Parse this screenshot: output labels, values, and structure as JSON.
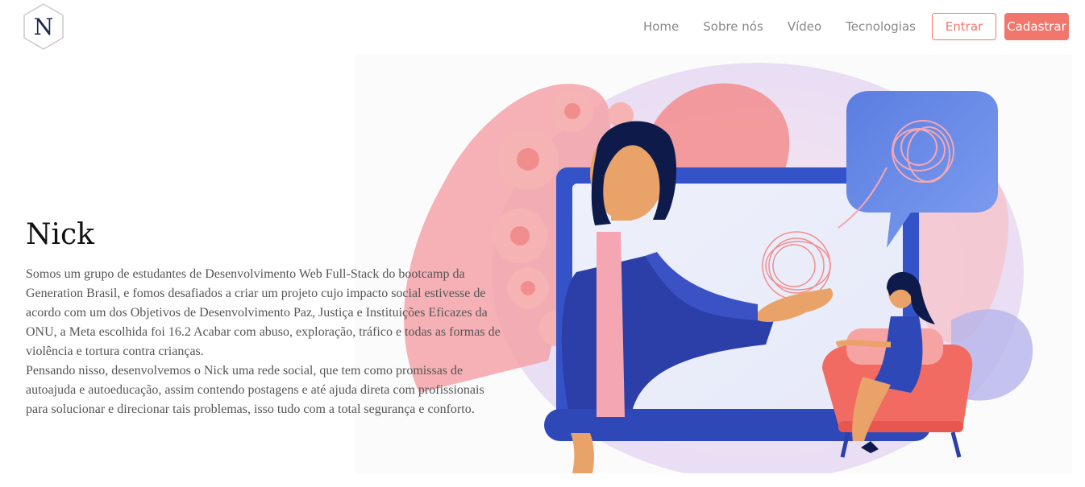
{
  "brand": {
    "logo_letter": "N"
  },
  "nav": {
    "links": [
      "Home",
      "Sobre nós",
      "Vídeo",
      "Tecnologias"
    ],
    "login_label": "Entrar",
    "signup_label": "Cadastrar"
  },
  "hero": {
    "title": "Nick",
    "paragraph_1": "Somos um grupo de estudantes de Desenvolvimento Web Full-Stack do bootcamp da Generation Brasil, e fomos desafiados a criar um projeto cujo impacto social estivesse de acordo com um dos Objetivos de Desenvolvimento Paz, Justiça e Instituições Eficazes da ONU, a Meta escolhida foi 16.2 Acabar com abuso, exploração, tráfico e todas as formas de violência e tortura contra crianças.",
    "paragraph_2": "Pensando nisso, desenvolvemos o Nick uma rede social, que tem como promissas de autoajuda e autoeducação, assim contendo postagens e até ajuda direta com profissionais para solucionar e direcionar tais problemas, isso tudo com a total segurança e conforto."
  },
  "colors": {
    "accent": "#f1766b",
    "navy": "#1d2a6b",
    "blue": "#3e5bd0"
  }
}
